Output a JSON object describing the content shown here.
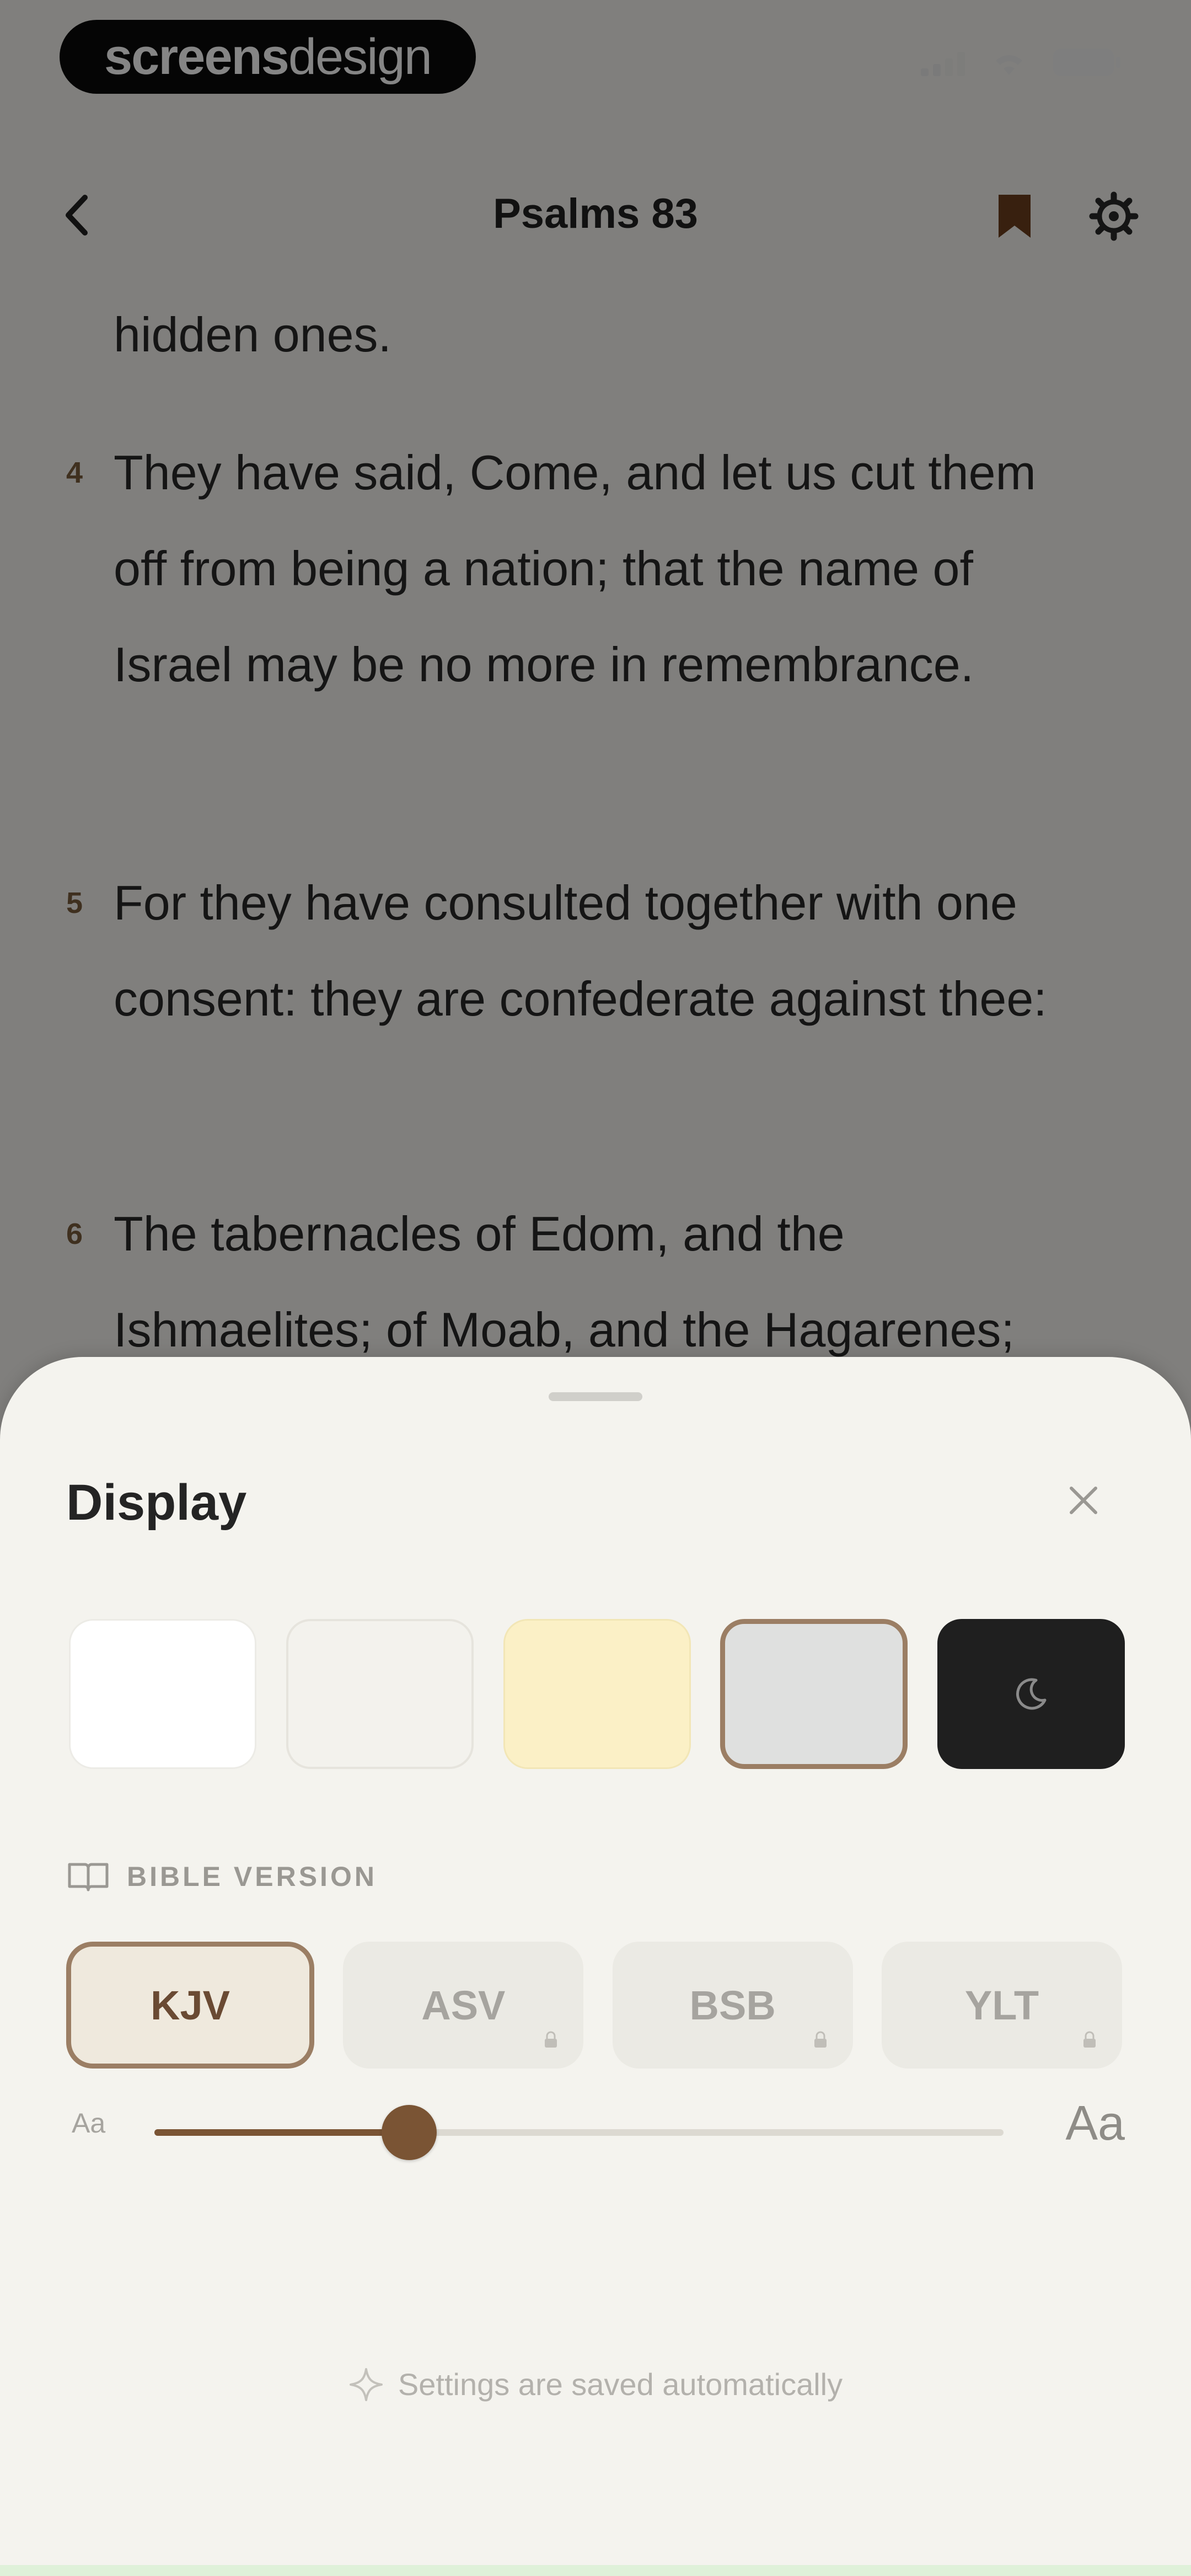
{
  "status_bar": {
    "logo_bold": "screens",
    "logo_light": "design"
  },
  "nav": {
    "title": "Psalms 83"
  },
  "verses": [
    {
      "num": "",
      "text": "hidden ones."
    },
    {
      "num": "4",
      "text": "They have said, Come, and let us cut them off from being a nation; that the name of Israel may be no more in remembrance."
    },
    {
      "num": "5",
      "text": "For they have consulted together with one consent: they are confederate against thee:"
    },
    {
      "num": "6",
      "text": "The tabernacles of Edom, and the Ishmaelites; of Moab, and the Hagarenes;"
    }
  ],
  "sheet": {
    "title": "Display",
    "themes": [
      {
        "name": "white",
        "color": "#ffffff"
      },
      {
        "name": "cream",
        "color": "#f3f2ed"
      },
      {
        "name": "sepia",
        "color": "#fbf0c6"
      },
      {
        "name": "gray",
        "color": "#dfe0df",
        "selected": true
      },
      {
        "name": "dark",
        "color": "#1f1f1f"
      }
    ],
    "bible_version_label": "BIBLE VERSION",
    "versions": [
      {
        "label": "KJV",
        "active": true,
        "locked": false
      },
      {
        "label": "ASV",
        "active": false,
        "locked": true
      },
      {
        "label": "BSB",
        "active": false,
        "locked": true
      },
      {
        "label": "YLT",
        "active": false,
        "locked": true
      }
    ],
    "font_size": {
      "small_label": "Aa",
      "large_label": "Aa",
      "value_fraction": 0.3
    },
    "footer_note": "Settings are saved automatically"
  },
  "colors": {
    "accent": "#7a5434",
    "selected_border": "#9b7e64",
    "verse_number": "#7a5c3d"
  }
}
